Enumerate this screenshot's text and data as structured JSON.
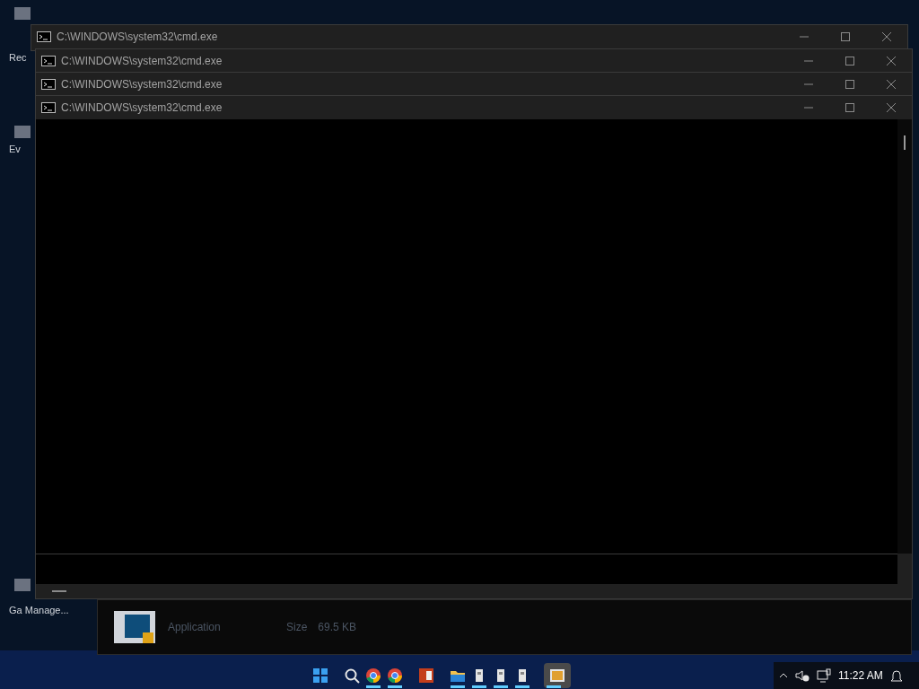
{
  "desktop_icons": [
    {
      "label": "Rec"
    },
    {
      "label": "Ev"
    },
    {
      "label": "Ga Manage..."
    }
  ],
  "background_panel": {
    "type": "Application",
    "size_label": "Size",
    "size": "69.5 KB"
  },
  "windows": [
    {
      "title": "C:\\WINDOWS\\system32\\cmd.exe"
    },
    {
      "title": "C:\\WINDOWS\\system32\\cmd.exe"
    },
    {
      "title": "C:\\WINDOWS\\system32\\cmd.exe"
    },
    {
      "title": "C:\\WINDOWS\\system32\\cmd.exe"
    }
  ],
  "taskbar": {
    "apps": [
      {
        "kind": "start",
        "running": false,
        "selected": false
      },
      {
        "kind": "search",
        "running": false,
        "selected": false
      },
      {
        "kind": "chrome",
        "running": true,
        "selected": false
      },
      {
        "kind": "chrome",
        "running": true,
        "selected": false
      },
      {
        "kind": "powerpoint",
        "running": false,
        "selected": false
      },
      {
        "kind": "folder",
        "running": true,
        "selected": false
      },
      {
        "kind": "console",
        "running": true,
        "selected": false
      },
      {
        "kind": "console",
        "running": true,
        "selected": false
      },
      {
        "kind": "console",
        "running": true,
        "selected": false
      },
      {
        "kind": "picture",
        "running": true,
        "selected": true
      }
    ],
    "clock": "11:22 AM"
  }
}
